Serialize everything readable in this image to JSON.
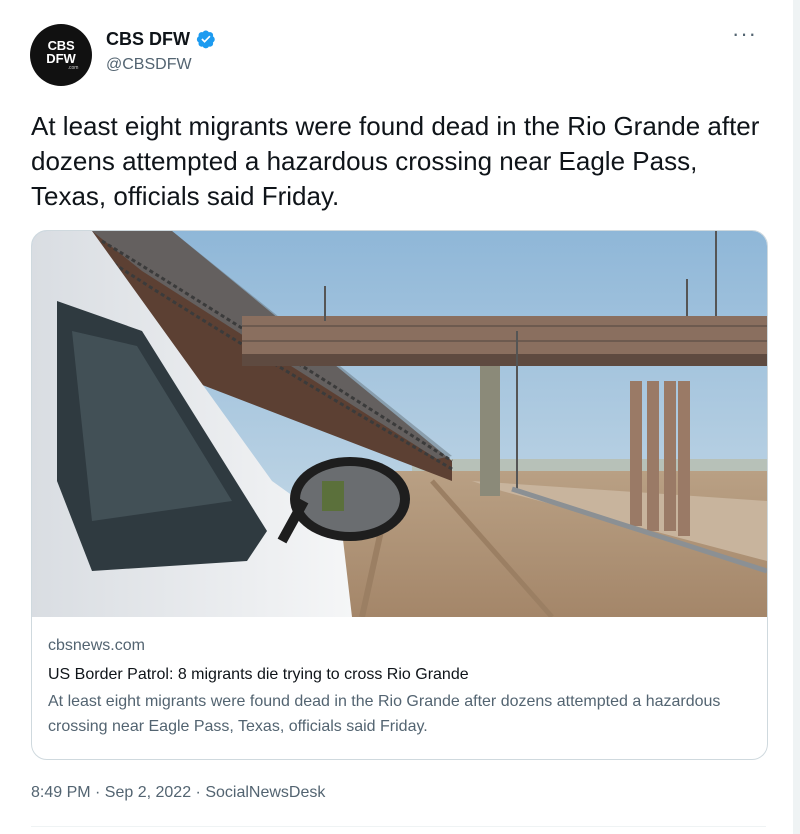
{
  "author": {
    "name": "CBS DFW",
    "handle": "@CBSDFW",
    "avatar_line1": "CBS",
    "avatar_line2": "DFW",
    "avatar_line3": ".com",
    "verified_icon": "verified-badge-icon"
  },
  "more_label": "···",
  "tweet_text": "At least eight migrants were found dead in the Rio Grande after dozens attempted a hazardous crossing near Eagle Pass, Texas, officials said Friday.",
  "card": {
    "domain": "cbsnews.com",
    "title": "US Border Patrol: 8 migrants die trying to cross Rio Grande",
    "description": "At least eight migrants were found dead in the Rio Grande after dozens attempted a hazardous crossing near Eagle Pass, Texas, officials said Friday."
  },
  "timestamp": "8:49 PM · Sep 2, 2022 · SocialNewsDesk",
  "colors": {
    "verified_blue": "#1d9bf0",
    "secondary_text": "#536471",
    "border": "#cfd9de"
  }
}
